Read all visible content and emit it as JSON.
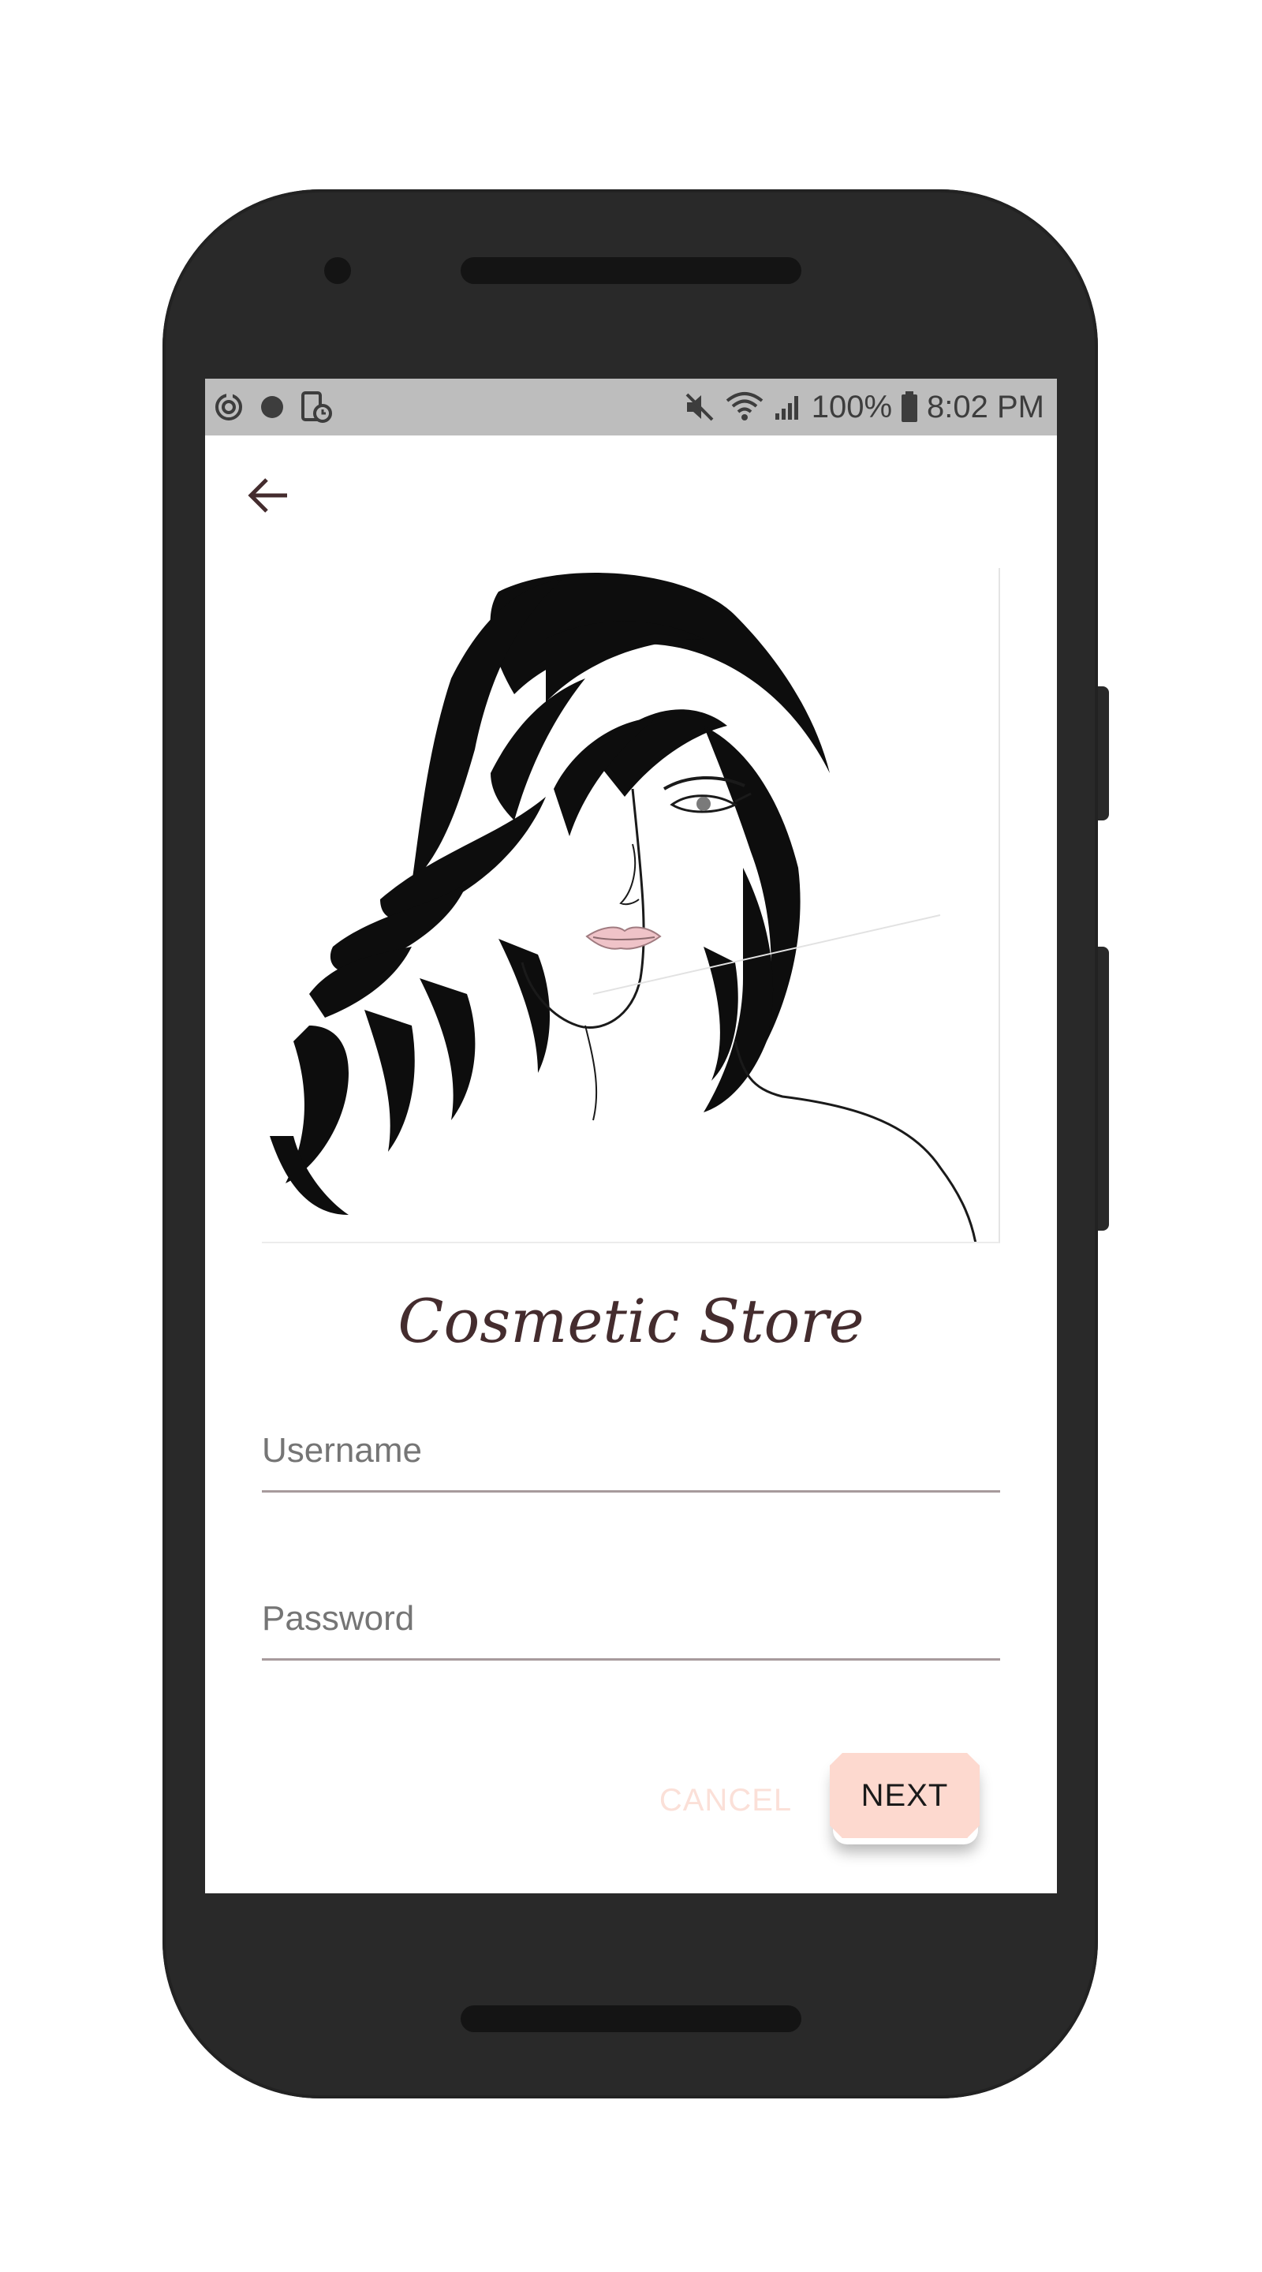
{
  "status_bar": {
    "left_icons": [
      "sync-icon",
      "notification-dot-icon",
      "screenshot-icon"
    ],
    "right_icons": [
      "mute-icon",
      "wifi-icon",
      "signal-icon"
    ],
    "battery": "100%",
    "time": "8:02 PM"
  },
  "app": {
    "title": "Cosmetic Store",
    "back_icon": "arrow-back-icon",
    "illustration": "woman-portrait-illustration"
  },
  "form": {
    "username_placeholder": "Username",
    "password_placeholder": "Password",
    "cancel_label": "CANCEL",
    "next_label": "NEXT"
  },
  "colors": {
    "primary_text": "#442c2e",
    "accent": "#fdd9cf",
    "cancel_text": "#fbe0d8",
    "device": "#292929"
  }
}
